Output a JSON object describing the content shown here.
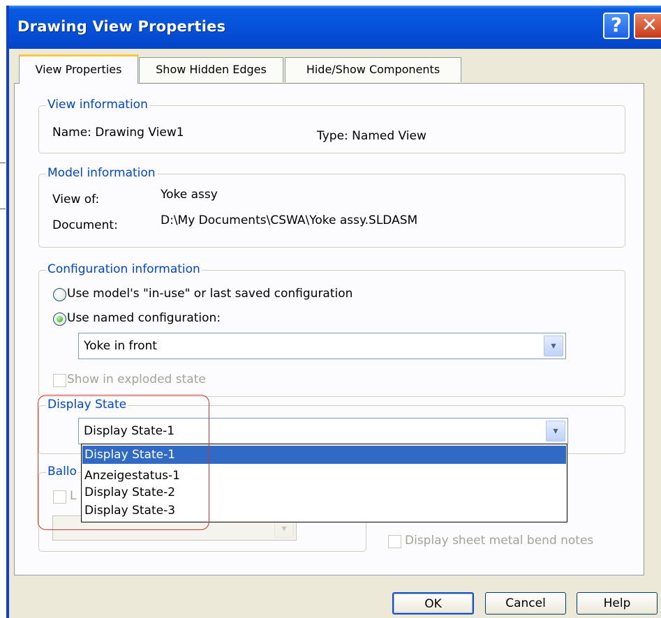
{
  "window": {
    "title": "Drawing View Properties",
    "help_glyph": "?",
    "close_glyph": "✕"
  },
  "tabs": [
    {
      "label": "View Properties",
      "active": true
    },
    {
      "label": "Show Hidden Edges",
      "active": false
    },
    {
      "label": "Hide/Show Components",
      "active": false
    }
  ],
  "view_information": {
    "legend": "View information",
    "name": "Name: Drawing View1",
    "type": "Type: Named View"
  },
  "model_information": {
    "legend": "Model information",
    "view_of_label": "View of:",
    "view_of_value": "Yoke assy",
    "document_label": "Document:",
    "document_value": "D:\\My Documents\\CSWA\\Yoke assy.SLDASM"
  },
  "configuration_information": {
    "legend": "Configuration information",
    "option_in_use": "Use model's \"in-use\" or last saved configuration",
    "option_named": "Use named configuration:",
    "selected_option": "named",
    "named_configuration": "Yoke in front",
    "show_exploded_label": "Show in exploded state",
    "show_exploded_checked": false
  },
  "display_state": {
    "legend": "Display State",
    "selected": "Display State-1",
    "options": [
      "Display State-1",
      "Anzeigestatus-1",
      "Display State-2",
      "Display State-3"
    ],
    "highlighted_index": 0
  },
  "balloons": {
    "legend_visible_fragment": "Ballo",
    "checkbox_fragment": "L"
  },
  "sheet_metal": {
    "bend_notes_label": "Display sheet metal bend notes",
    "bend_notes_checked": false
  },
  "buttons": {
    "ok": "OK",
    "cancel": "Cancel",
    "help": "Help"
  },
  "colors": {
    "titlebar": "#0653dc",
    "legend_text": "#0046d5",
    "dialog_face": "#ece9d8",
    "selection": "#316ac5",
    "annotation_outline": "#e0302c"
  }
}
